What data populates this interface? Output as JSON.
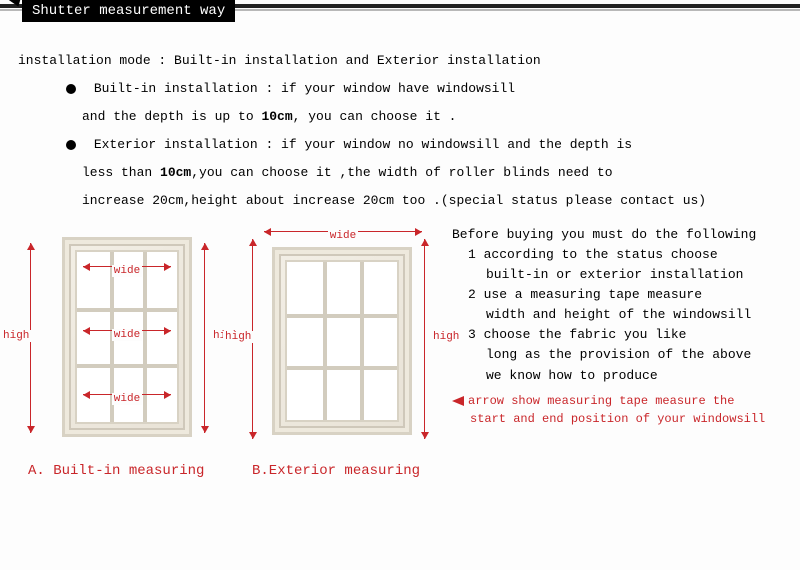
{
  "header": {
    "title": "Shutter measurement way"
  },
  "intro": "installation mode : Built-in installation and Exterior installation",
  "bullet1": {
    "line1a": "Built-in installation : if your window have windowsill",
    "line1b_pre": "and the depth is up to ",
    "line1b_bold": "10cm",
    "line1b_post": ", you can choose it ."
  },
  "bullet2": {
    "line2a": "Exterior installation : if your window no windowsill and the depth is",
    "line2b_pre": "less than ",
    "line2b_bold": "10cm",
    "line2b_post": ",you can choose it ,the width of roller blinds need to",
    "line2c": "increase 20cm,height about increase 20cm too .(special status please contact us)"
  },
  "diagA": {
    "wide": "wide",
    "high": "high",
    "caption": "A. Built-in measuring"
  },
  "diagB": {
    "wide": "wide",
    "high": "high",
    "caption": "B.Exterior measuring"
  },
  "instructions": {
    "intro": "Before buying you must do the following",
    "s1": "1 according to the status choose",
    "s1b": "built-in or exterior installation",
    "s2": "2 use a measuring tape measure",
    "s2b": "width and height of the windowsill",
    "s3": "3 choose the fabric you like",
    "s3b": "long as the provision of the above",
    "s3c": "we know how to produce",
    "note1": "arrow show measuring tape measure the",
    "note2": "start and end position of your windowsill"
  }
}
